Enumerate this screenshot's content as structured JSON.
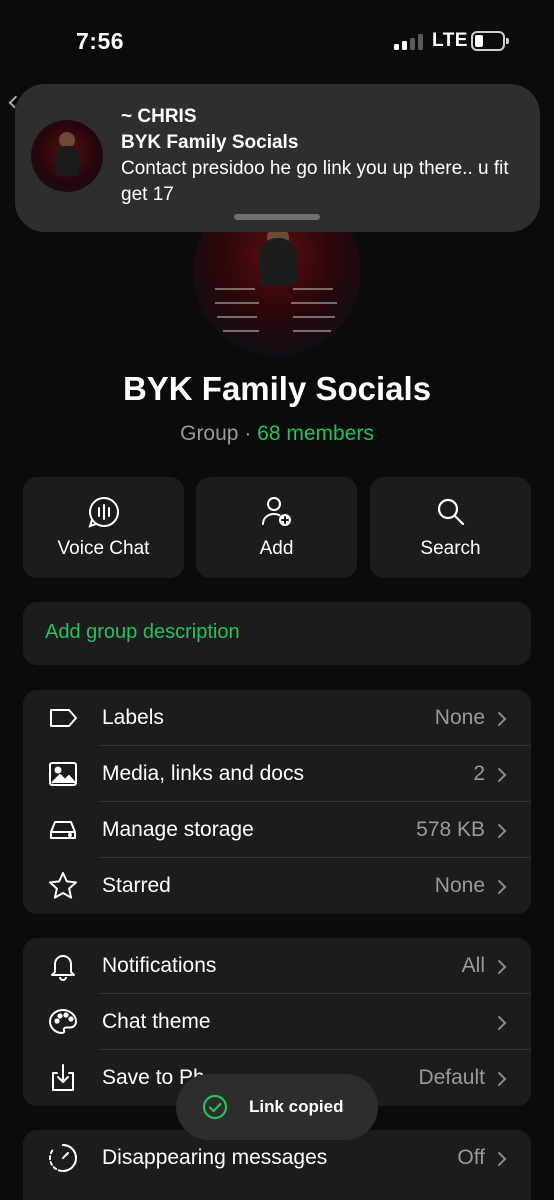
{
  "status_bar": {
    "time": "7:56",
    "network": "LTE",
    "signal_bars": 2,
    "battery_level": 0.2
  },
  "notification": {
    "sender": "~ CHRIS",
    "group": "BYK Family Socials",
    "message": "Contact presidoo he go link you up there.. u fit get 17"
  },
  "group": {
    "name": "BYK Family Socials",
    "type_label": "Group",
    "separator": " · ",
    "members": "68 members"
  },
  "actions": [
    {
      "label": "Voice Chat",
      "icon": "voice-chat-icon"
    },
    {
      "label": "Add",
      "icon": "add-member-icon"
    },
    {
      "label": "Search",
      "icon": "search-icon"
    }
  ],
  "description": {
    "label": "Add group description"
  },
  "settings_group_1": [
    {
      "label": "Labels",
      "value": "None",
      "icon": "label-icon"
    },
    {
      "label": "Media, links and docs",
      "value": "2",
      "icon": "image-icon"
    },
    {
      "label": "Manage storage",
      "value": "578 KB",
      "icon": "storage-icon"
    },
    {
      "label": "Starred",
      "value": "None",
      "icon": "star-icon"
    }
  ],
  "settings_group_2": [
    {
      "label": "Notifications",
      "value": "All",
      "icon": "bell-icon"
    },
    {
      "label": "Chat theme",
      "value": "",
      "icon": "palette-icon"
    },
    {
      "label": "Save to Ph",
      "value": "Default",
      "icon": "download-icon"
    }
  ],
  "settings_group_3": [
    {
      "label": "Disappearing messages",
      "value": "Off",
      "icon": "timer-icon"
    }
  ],
  "toast": {
    "label": "Link copied",
    "icon": "check-circle-icon"
  },
  "colors": {
    "accent": "#25c15c",
    "background": "#0b0b0b",
    "card": "#1c1c1c",
    "secondary_text": "#9a9a9a"
  }
}
